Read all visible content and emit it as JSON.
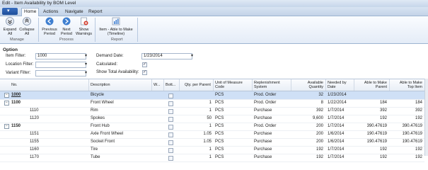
{
  "window": {
    "title": "Edit - Item Availability by BOM Level"
  },
  "ribbon": {
    "tabs": [
      "Home",
      "Actions",
      "Navigate",
      "Report"
    ],
    "buttons": {
      "expand": "Expand All",
      "collapse": "Collapse All",
      "prev": "Previous Period",
      "next": "Next Period",
      "warnings": "Show Warnings",
      "able": "Item - Able to Make (Timeline)"
    },
    "groups": {
      "manage": "Manage",
      "process": "Process",
      "report": "Report"
    }
  },
  "options": {
    "title": "Option",
    "item_filter_label": "Item Filter:",
    "item_filter_value": "1000",
    "location_filter_label": "Location Filter:",
    "variant_filter_label": "Variant Filter:",
    "demand_date_label": "Demand Date:",
    "demand_date_value": "1/23/2014",
    "calculated_label": "Calculated:",
    "calculated_checked": true,
    "show_total_label": "Show Total Availability:",
    "show_total_checked": true
  },
  "grid": {
    "columns": {
      "no": "No.",
      "desc": "Description",
      "w": "W...",
      "bott": "Bott...",
      "qty": "Qty. per Parent",
      "uom1": "Unit of Measure",
      "uom2": "Code",
      "rep1": "Replenishment",
      "rep2": "System",
      "avail1": "Available",
      "avail2": "Quantity",
      "needed1": "Needed by",
      "needed2": "Date",
      "abp1": "Able to Make",
      "abp2": "Parent",
      "abt1": "Able to Make",
      "abt2": "Top Item"
    },
    "rows": [
      {
        "no": "1000",
        "desc": "Bicycle",
        "qty": "",
        "uom": "PCS",
        "rep": "Prod. Order",
        "avail": "32",
        "needed": "1/23/2014",
        "abp": "",
        "abt": "",
        "bold": true,
        "indent": 0,
        "toggle": "−"
      },
      {
        "no": "1100",
        "desc": "Front Wheel",
        "qty": "1",
        "uom": "PCS",
        "rep": "Prod. Order",
        "avail": "8",
        "needed": "1/22/2014",
        "abp": "184",
        "abt": "184",
        "bold": true,
        "indent": 1,
        "toggle": "−"
      },
      {
        "no": "1110",
        "desc": "Rim",
        "qty": "1",
        "uom": "PCS",
        "rep": "Purchase",
        "avail": "392",
        "needed": "1/7/2014",
        "abp": "392",
        "abt": "392",
        "bold": false,
        "indent": 2,
        "toggle": ""
      },
      {
        "no": "1120",
        "desc": "Spokes",
        "qty": "50",
        "uom": "PCS",
        "rep": "Purchase",
        "avail": "9,600",
        "needed": "1/7/2014",
        "abp": "192",
        "abt": "192",
        "bold": false,
        "indent": 2,
        "toggle": ""
      },
      {
        "no": "1150",
        "desc": "Front Hub",
        "qty": "1",
        "uom": "PCS",
        "rep": "Prod. Order",
        "avail": "200",
        "needed": "1/7/2014",
        "abp": "390.47619",
        "abt": "390.47619",
        "bold": true,
        "indent": 1,
        "toggle": "−"
      },
      {
        "no": "1151",
        "desc": "Axle Front Wheel",
        "qty": "1.05",
        "uom": "PCS",
        "rep": "Purchase",
        "avail": "200",
        "needed": "1/6/2014",
        "abp": "190.47619",
        "abt": "190.47619",
        "bold": false,
        "indent": 3,
        "toggle": ""
      },
      {
        "no": "1155",
        "desc": "Socket Front",
        "qty": "1.05",
        "uom": "PCS",
        "rep": "Purchase",
        "avail": "200",
        "needed": "1/6/2014",
        "abp": "190.47619",
        "abt": "190.47619",
        "bold": false,
        "indent": 3,
        "toggle": ""
      },
      {
        "no": "1160",
        "desc": "Tire",
        "qty": "1",
        "uom": "PCS",
        "rep": "Purchase",
        "avail": "192",
        "needed": "1/7/2014",
        "abp": "192",
        "abt": "192",
        "bold": false,
        "indent": 2,
        "toggle": ""
      },
      {
        "no": "1170",
        "desc": "Tube",
        "qty": "1",
        "uom": "PCS",
        "rep": "Purchase",
        "avail": "192",
        "needed": "1/7/2014",
        "abp": "192",
        "abt": "192",
        "bold": false,
        "indent": 2,
        "toggle": ""
      }
    ]
  },
  "colors": {
    "selection": "#cfe0f6",
    "ribbon_border": "#9db4d1",
    "app_button": "#1d4e9a"
  },
  "icons": [
    "expand-all-icon",
    "collapse-all-icon",
    "previous-period-icon",
    "next-period-icon",
    "show-warnings-icon",
    "able-to-make-icon"
  ]
}
